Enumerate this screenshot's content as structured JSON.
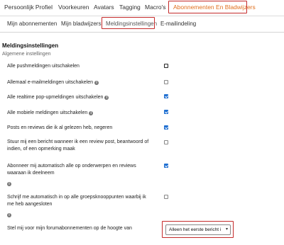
{
  "top_tabs": [
    {
      "label": "Persoonlijk Profiel"
    },
    {
      "label": "Voorkeuren"
    },
    {
      "label": "Avatars"
    },
    {
      "label": "Tagging"
    },
    {
      "label": "Macro's"
    },
    {
      "label": "Abonnementen En Bladwijzers",
      "active": true
    }
  ],
  "sub_tabs": [
    {
      "label": "Mijn abonnementen"
    },
    {
      "label": "Mijn bladwijzers"
    },
    {
      "label": "Meldingsinstellingen",
      "active": true
    },
    {
      "label": "E-mailindeling"
    }
  ],
  "section": {
    "heading": "Meldingsinstellingen",
    "subheading": "Algemene instellingen"
  },
  "settings": [
    {
      "label": "Alle pushmeldingen uitschakelen",
      "info": false,
      "checked": false,
      "focused": true
    },
    {
      "label": "Allemaal e-mailmeldingen uitschakelen",
      "info": true,
      "checked": false
    },
    {
      "label": "Alle realtime pop-upmeldingen uitschakelen",
      "info": true,
      "checked": true
    },
    {
      "label": "Alle mobiele meldingen uitschakelen",
      "info": true,
      "checked": true
    },
    {
      "label": "Posts en reviews die ik al gelezen heb, negeren",
      "info": false,
      "checked": true
    },
    {
      "label": "Stuur mij een bericht wanneer ik een review post, beantwoord of indien, of een opmerking maak",
      "info": false,
      "checked": false
    },
    {
      "label": "Abonneer mij automatisch alle op onderwerpen en reviews waaraan ik deelneem",
      "info": false,
      "checked": true
    },
    {
      "label": "Schrijf me automatisch in op alle groepsknooppunten waarbij ik me heb aangesloten",
      "info": false,
      "checked": false
    },
    {
      "label": "Stel mij voor mijn forumabonnementen op de hoogte van",
      "info": false
    }
  ],
  "info_glyph": "i",
  "forum_select": {
    "value": "Alleen het eerste bericht i",
    "chevron": "▾"
  },
  "colors": {
    "accent": "#e0701f",
    "highlight": "#c42a2a",
    "checkbox": "#1f6fd1"
  }
}
